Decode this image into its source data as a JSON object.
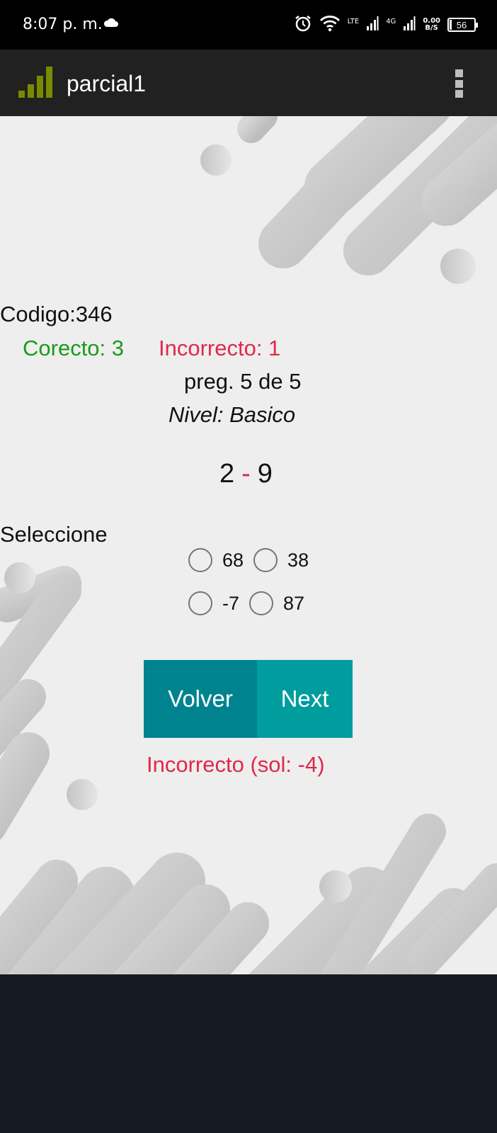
{
  "status_bar": {
    "time": "8:07 p. m.",
    "network_lte": "LTE",
    "network_4g": "4G",
    "speed_value": "0.00",
    "speed_unit": "B/S",
    "battery": "56"
  },
  "app_bar": {
    "title": "parcial1"
  },
  "quiz": {
    "codigo": "Codigo:346",
    "correcto": "Corecto: 3",
    "incorrecto": "Incorrecto: 1",
    "pregunta": "preg. 5 de 5",
    "nivel": "Nivel: Basico",
    "operand_a": "2",
    "operator": "-",
    "operand_b": "9",
    "seleccione": "Seleccione",
    "options": [
      "68",
      "38",
      "-7",
      "87"
    ],
    "result": "Incorrecto (sol: -4)"
  },
  "buttons": {
    "volver": "Volver",
    "next": "Next"
  },
  "colors": {
    "correct": "#1a9a1a",
    "incorrect": "#e0284a",
    "btn_volver": "#00838f",
    "btn_next": "#009c9e",
    "logo": "#7a8a00"
  }
}
